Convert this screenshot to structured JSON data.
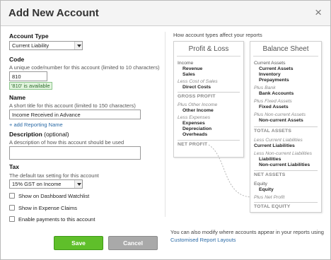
{
  "dialog": {
    "title": "Add New Account",
    "close_glyph": "×"
  },
  "form": {
    "account_type": {
      "label": "Account Type",
      "value": "Current Liability"
    },
    "code": {
      "label": "Code",
      "hint": "A unique code/number for this account (limited to 10 characters)",
      "value": "810",
      "status": "'810' is available"
    },
    "name": {
      "label": "Name",
      "hint": "A short title for this account (limited to 150 characters)",
      "value": "Income Received in Advance",
      "add_link": "+ add Reporting Name"
    },
    "description": {
      "label": "Description",
      "optional": "(optional)",
      "hint": "A description of how this account should be used",
      "value": ""
    },
    "tax": {
      "label": "Tax",
      "hint": "The default tax setting for this account",
      "value": "15% GST on Income"
    },
    "checkboxes": [
      {
        "label": "Show on Dashboard Watchlist",
        "checked": false
      },
      {
        "label": "Show in Expense Claims",
        "checked": false
      },
      {
        "label": "Enable payments to this account",
        "checked": false
      }
    ],
    "save_label": "Save",
    "cancel_label": "Cancel"
  },
  "info": {
    "title": "How account types affect your reports",
    "pl": {
      "title": "Profit & Loss",
      "lines": [
        "Income",
        "Revenue",
        "Sales",
        "Less Cost of Sales",
        "Direct Costs",
        "GROSS PROFIT",
        "Plus Other Income",
        "Other Income",
        "Less Expenses",
        "Expenses",
        "Depreciation",
        "Overheads",
        "NET PROFIT"
      ]
    },
    "bs": {
      "title": "Balance Sheet",
      "lines": [
        "Current Assets",
        "Current Assets",
        "Inventory",
        "Prepayments",
        "Plus Bank",
        "Bank Accounts",
        "Plus Fixed Assets",
        "Fixed Assets",
        "Plus Non-current Assets",
        "Non-current Assets",
        "TOTAL ASSETS",
        "Less Current Liabilities",
        "Current Liabilities",
        "Less Non-current Liabilities",
        "Liabilities",
        "Non-current Liabilities",
        "NET ASSETS",
        "Equity",
        "Equity",
        "Plus Net Profit",
        "TOTAL EQUITY"
      ]
    },
    "footnote": "You can also modify where accounts appear in your reports using",
    "footnote_link": "Customised Report Layouts"
  },
  "colors": {
    "save": "#5fbf2a",
    "cancel": "#a9a9a9",
    "link": "#2a6aa6",
    "available": "#2f6d2f"
  }
}
